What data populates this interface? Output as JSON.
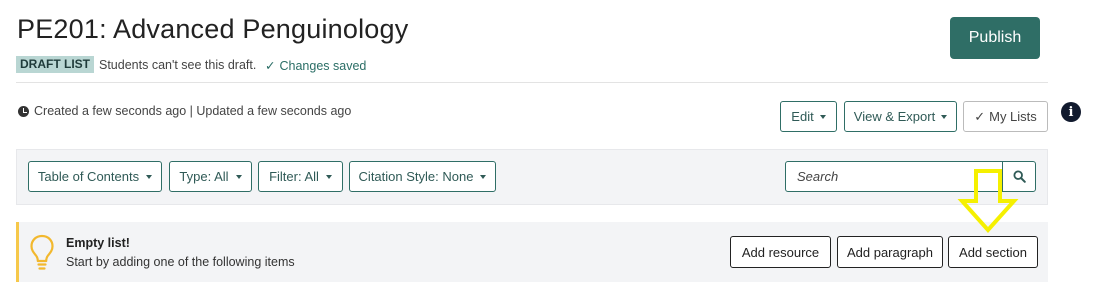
{
  "header": {
    "title": "PE201: Advanced Penguinology",
    "badge": "DRAFT LIST",
    "draft_note": "Students can't see this draft.",
    "saved_status": "Changes saved",
    "publish_label": "Publish"
  },
  "meta": {
    "timestamps": "Created a few seconds ago | Updated a few seconds ago"
  },
  "actions": {
    "edit": "Edit",
    "view_export": "View & Export",
    "my_lists": "My Lists"
  },
  "toolbar": {
    "table_of_contents": "Table of Contents",
    "type": "Type: All",
    "filter": "Filter: All",
    "citation_style": "Citation Style: None",
    "search_placeholder": "Search"
  },
  "empty_state": {
    "title": "Empty list!",
    "subtitle": "Start by adding one of the following items",
    "add_resource": "Add resource",
    "add_paragraph": "Add paragraph",
    "add_section": "Add section"
  },
  "colors": {
    "accent": "#2f6e66",
    "badge_bg": "#b9d6d3",
    "empty_border": "#f6c84a",
    "annotation_arrow": "#f5f000"
  },
  "icons": {
    "clock": "clock-icon",
    "check": "check-icon",
    "info": "info-icon",
    "search": "search-icon",
    "bulb": "lightbulb-icon",
    "annotation": "down-arrow-annotation"
  }
}
